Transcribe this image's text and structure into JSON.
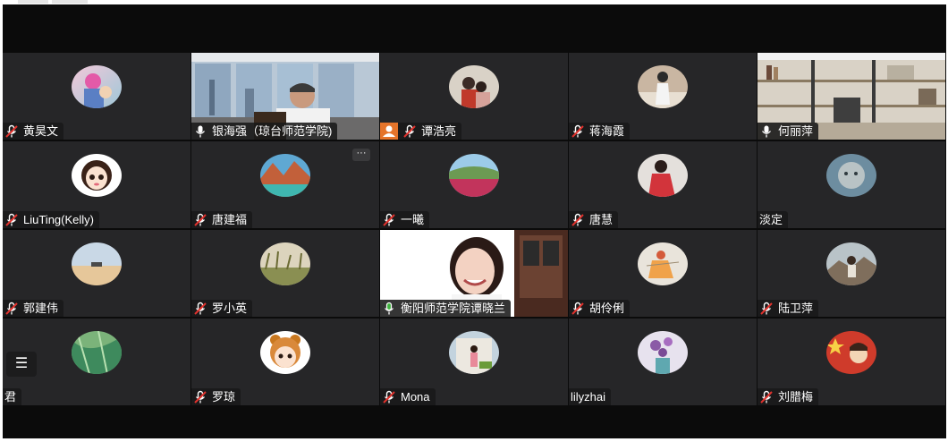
{
  "meeting": {
    "participants": [
      {
        "name": "黄昊文",
        "mic": "muted",
        "kind": "avatar"
      },
      {
        "name": "银海强（琼台师范学院)",
        "mic": "on",
        "kind": "video"
      },
      {
        "name": "谭浩亮",
        "mic": "muted",
        "kind": "avatar",
        "host": true
      },
      {
        "name": "蒋海霞",
        "mic": "muted",
        "kind": "avatar"
      },
      {
        "name": "何丽萍",
        "mic": "on",
        "kind": "video"
      },
      {
        "name": "LiuTing(Kelly)",
        "mic": "muted",
        "kind": "avatar"
      },
      {
        "name": "唐建福",
        "mic": "muted",
        "kind": "avatar",
        "more": "···"
      },
      {
        "name": "一曦",
        "mic": "muted",
        "kind": "avatar"
      },
      {
        "name": "唐慧",
        "mic": "muted",
        "kind": "avatar"
      },
      {
        "name": "淡定",
        "mic": "none",
        "kind": "avatar"
      },
      {
        "name": "郭建伟",
        "mic": "muted",
        "kind": "avatar"
      },
      {
        "name": "罗小英",
        "mic": "muted",
        "kind": "avatar"
      },
      {
        "name": "衡阳师范学院谭晓兰",
        "mic": "speaking",
        "kind": "video",
        "active": true
      },
      {
        "name": "胡伶俐",
        "mic": "muted",
        "kind": "avatar"
      },
      {
        "name": "陆卫萍",
        "mic": "muted",
        "kind": "avatar"
      },
      {
        "name": "君",
        "mic": "none",
        "kind": "avatar",
        "list_button": "☰"
      },
      {
        "name": "罗琼",
        "mic": "muted",
        "kind": "avatar"
      },
      {
        "name": "Mona",
        "mic": "muted",
        "kind": "avatar"
      },
      {
        "name": "lilyzhai",
        "mic": "none",
        "kind": "avatar"
      },
      {
        "name": "刘腊梅",
        "mic": "muted",
        "kind": "avatar"
      }
    ]
  },
  "colors": {
    "tile_bg": "#262628",
    "meeting_bg": "#0b0b0b",
    "speaking_green": "#3fb33f",
    "host_orange": "#e5742a",
    "muted_red": "#e0322d"
  },
  "icons": {
    "muted": "mic-muted-icon",
    "on": "mic-icon",
    "speaking": "mic-speaking-icon",
    "host": "host-person-icon",
    "more": "more-dots-icon",
    "list": "list-icon"
  }
}
